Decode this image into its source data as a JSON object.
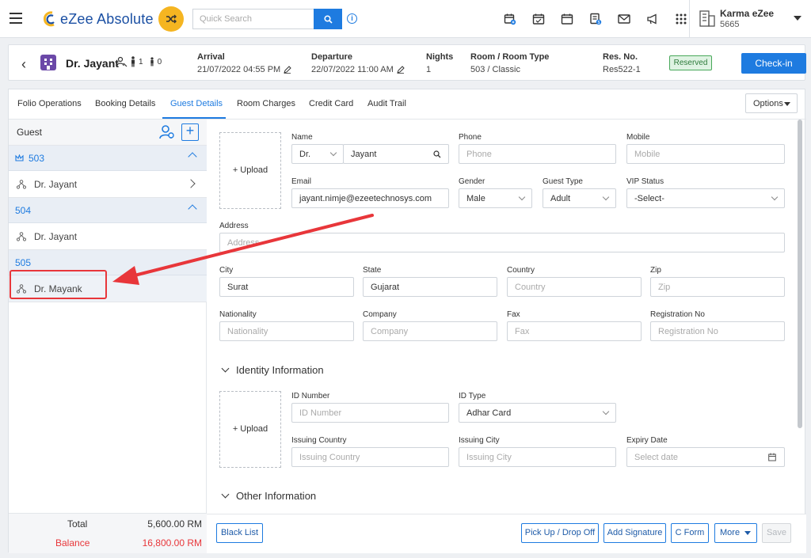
{
  "topbar": {
    "app_name": "eZee Absolute",
    "search_placeholder": "Quick Search",
    "user_name": "Karma eZee",
    "user_id": "5665",
    "icons": [
      "calendar-add-icon",
      "calendar-check-icon",
      "calendar-icon",
      "invoice-icon",
      "mail-icon",
      "megaphone-icon",
      "apps-grid-icon"
    ]
  },
  "reservation": {
    "guest_name": "Dr. Jayant",
    "adults": "1",
    "children": "0",
    "arrival_label": "Arrival",
    "arrival_value": "21/07/2022 04:55 PM",
    "departure_label": "Departure",
    "departure_value": "22/07/2022 11:00 AM",
    "nights_label": "Nights",
    "nights_value": "1",
    "room_label": "Room / Room Type",
    "room_value": "503 / Classic",
    "resno_label": "Res. No.",
    "resno_value": "Res522-1",
    "status": "Reserved",
    "checkin_label": "Check-in"
  },
  "tabs": [
    {
      "label": "Folio Operations"
    },
    {
      "label": "Booking Details"
    },
    {
      "label": "Guest Details",
      "active": true
    },
    {
      "label": "Room Charges"
    },
    {
      "label": "Credit Card"
    },
    {
      "label": "Audit Trail"
    }
  ],
  "options_label": "Options",
  "guest_panel": {
    "title": "Guest",
    "rooms": [
      {
        "number": "503",
        "guests": [
          "Dr. Jayant"
        ]
      },
      {
        "number": "504",
        "guests": [
          "Dr. Jayant"
        ]
      },
      {
        "number": "505",
        "guests": [
          "Dr. Mayank"
        ]
      }
    ],
    "total_label": "Total",
    "total_value": "5,600.00 RM",
    "balance_label": "Balance",
    "balance_value": "16,800.00 RM"
  },
  "form": {
    "upload_label": "+ Upload",
    "name_label": "Name",
    "title_value": "Dr.",
    "name_value": "Jayant",
    "phone_label": "Phone",
    "phone_placeholder": "Phone",
    "mobile_label": "Mobile",
    "mobile_placeholder": "Mobile",
    "email_label": "Email",
    "email_value": "jayant.nimje@ezeetechnosys.com",
    "gender_label": "Gender",
    "gender_value": "Male",
    "guest_type_label": "Guest Type",
    "guest_type_value": "Adult",
    "vip_label": "VIP Status",
    "vip_value": "-Select-",
    "address_label": "Address",
    "address_placeholder": "Address",
    "city_label": "City",
    "city_value": "Surat",
    "state_label": "State",
    "state_value": "Gujarat",
    "country_label": "Country",
    "country_placeholder": "Country",
    "zip_label": "Zip",
    "zip_placeholder": "Zip",
    "nationality_label": "Nationality",
    "nationality_placeholder": "Nationality",
    "company_label": "Company",
    "company_placeholder": "Company",
    "fax_label": "Fax",
    "fax_placeholder": "Fax",
    "regno_label": "Registration No",
    "regno_placeholder": "Registration No",
    "identity_section": "Identity Information",
    "id_number_label": "ID Number",
    "id_number_placeholder": "ID Number",
    "id_type_label": "ID Type",
    "id_type_value": "Adhar Card",
    "issuing_country_label": "Issuing Country",
    "issuing_country_placeholder": "Issuing Country",
    "issuing_city_label": "Issuing City",
    "issuing_city_placeholder": "Issuing City",
    "expiry_label": "Expiry Date",
    "expiry_placeholder": "Select date",
    "other_section": "Other Information"
  },
  "actions": {
    "blacklist": "Black List",
    "pickup": "Pick Up / Drop Off",
    "signature": "Add Signature",
    "cform": "C Form",
    "more": "More",
    "save": "Save"
  },
  "colors": {
    "accent": "#1e7be0",
    "annotation": "#e8363a",
    "reserved_badge": "#48a85a",
    "balance": "#e8363a"
  }
}
